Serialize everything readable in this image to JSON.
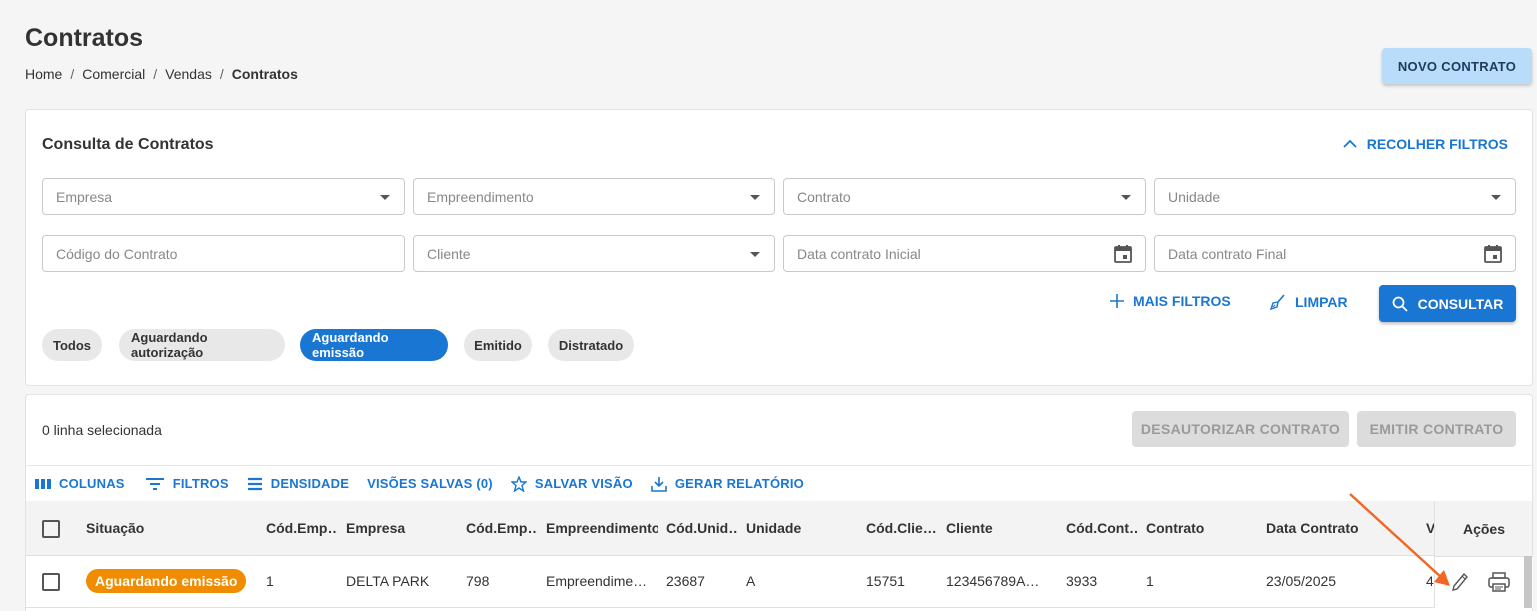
{
  "page": {
    "title": "Contratos",
    "breadcrumb": [
      "Home",
      "Comercial",
      "Vendas",
      "Contratos"
    ],
    "new_button": "NOVO CONTRATO"
  },
  "filters": {
    "title": "Consulta de Contratos",
    "collapse_label": "RECOLHER FILTROS",
    "fields_row1": [
      {
        "placeholder": "Empresa",
        "type": "select"
      },
      {
        "placeholder": "Empreendimento",
        "type": "select"
      },
      {
        "placeholder": "Contrato",
        "type": "select"
      },
      {
        "placeholder": "Unidade",
        "type": "select"
      }
    ],
    "fields_row2": [
      {
        "placeholder": "Código do Contrato",
        "type": "text"
      },
      {
        "placeholder": "Cliente",
        "type": "select"
      },
      {
        "placeholder": "Data contrato Inicial",
        "type": "date"
      },
      {
        "placeholder": "Data contrato Final",
        "type": "date"
      }
    ],
    "more_filters": "MAIS FILTROS",
    "clear": "LIMPAR",
    "search": "CONSULTAR",
    "chips": [
      "Todos",
      "Aguardando autorização",
      "Aguardando emissão",
      "Emitido",
      "Distratado"
    ],
    "active_chip": "Aguardando emissão"
  },
  "grid": {
    "selection_text": "0 linha selecionada",
    "unauthorize_button": "DESAUTORIZAR CONTRATO",
    "emit_button": "EMITIR CONTRATO",
    "toolbar": {
      "columns": "COLUNAS",
      "filters": "FILTROS",
      "density": "DENSIDADE",
      "saved_views": "VISÕES SALVAS (0)",
      "save_view": "SALVAR VISÃO",
      "report": "GERAR RELATÓRIO"
    },
    "headers": [
      "Situação",
      "Cód.Emp…",
      "Empresa",
      "Cód.Emp…",
      "Empreendimento",
      "Cód.Unid…",
      "Unidade",
      "Cód.Clie…",
      "Cliente",
      "Cód.Cont…",
      "Contrato",
      "Data Contrato",
      "V",
      "Ações"
    ],
    "rows": [
      {
        "status": "Aguardando emissão",
        "cod_empresa": "1",
        "empresa": "DELTA PARK",
        "cod_empreendimento": "798",
        "empreendimento": "Empreendime…",
        "cod_unidade": "23687",
        "unidade": "A",
        "cod_cliente": "15751",
        "cliente": "123456789A…",
        "cod_contrato": "3933",
        "contrato": "1",
        "data_contrato": "23/05/2025",
        "valor": "4"
      }
    ]
  },
  "colors": {
    "primary": "#1976d2",
    "status_orange": "#f08c00",
    "annotation_arrow": "#f26522"
  }
}
